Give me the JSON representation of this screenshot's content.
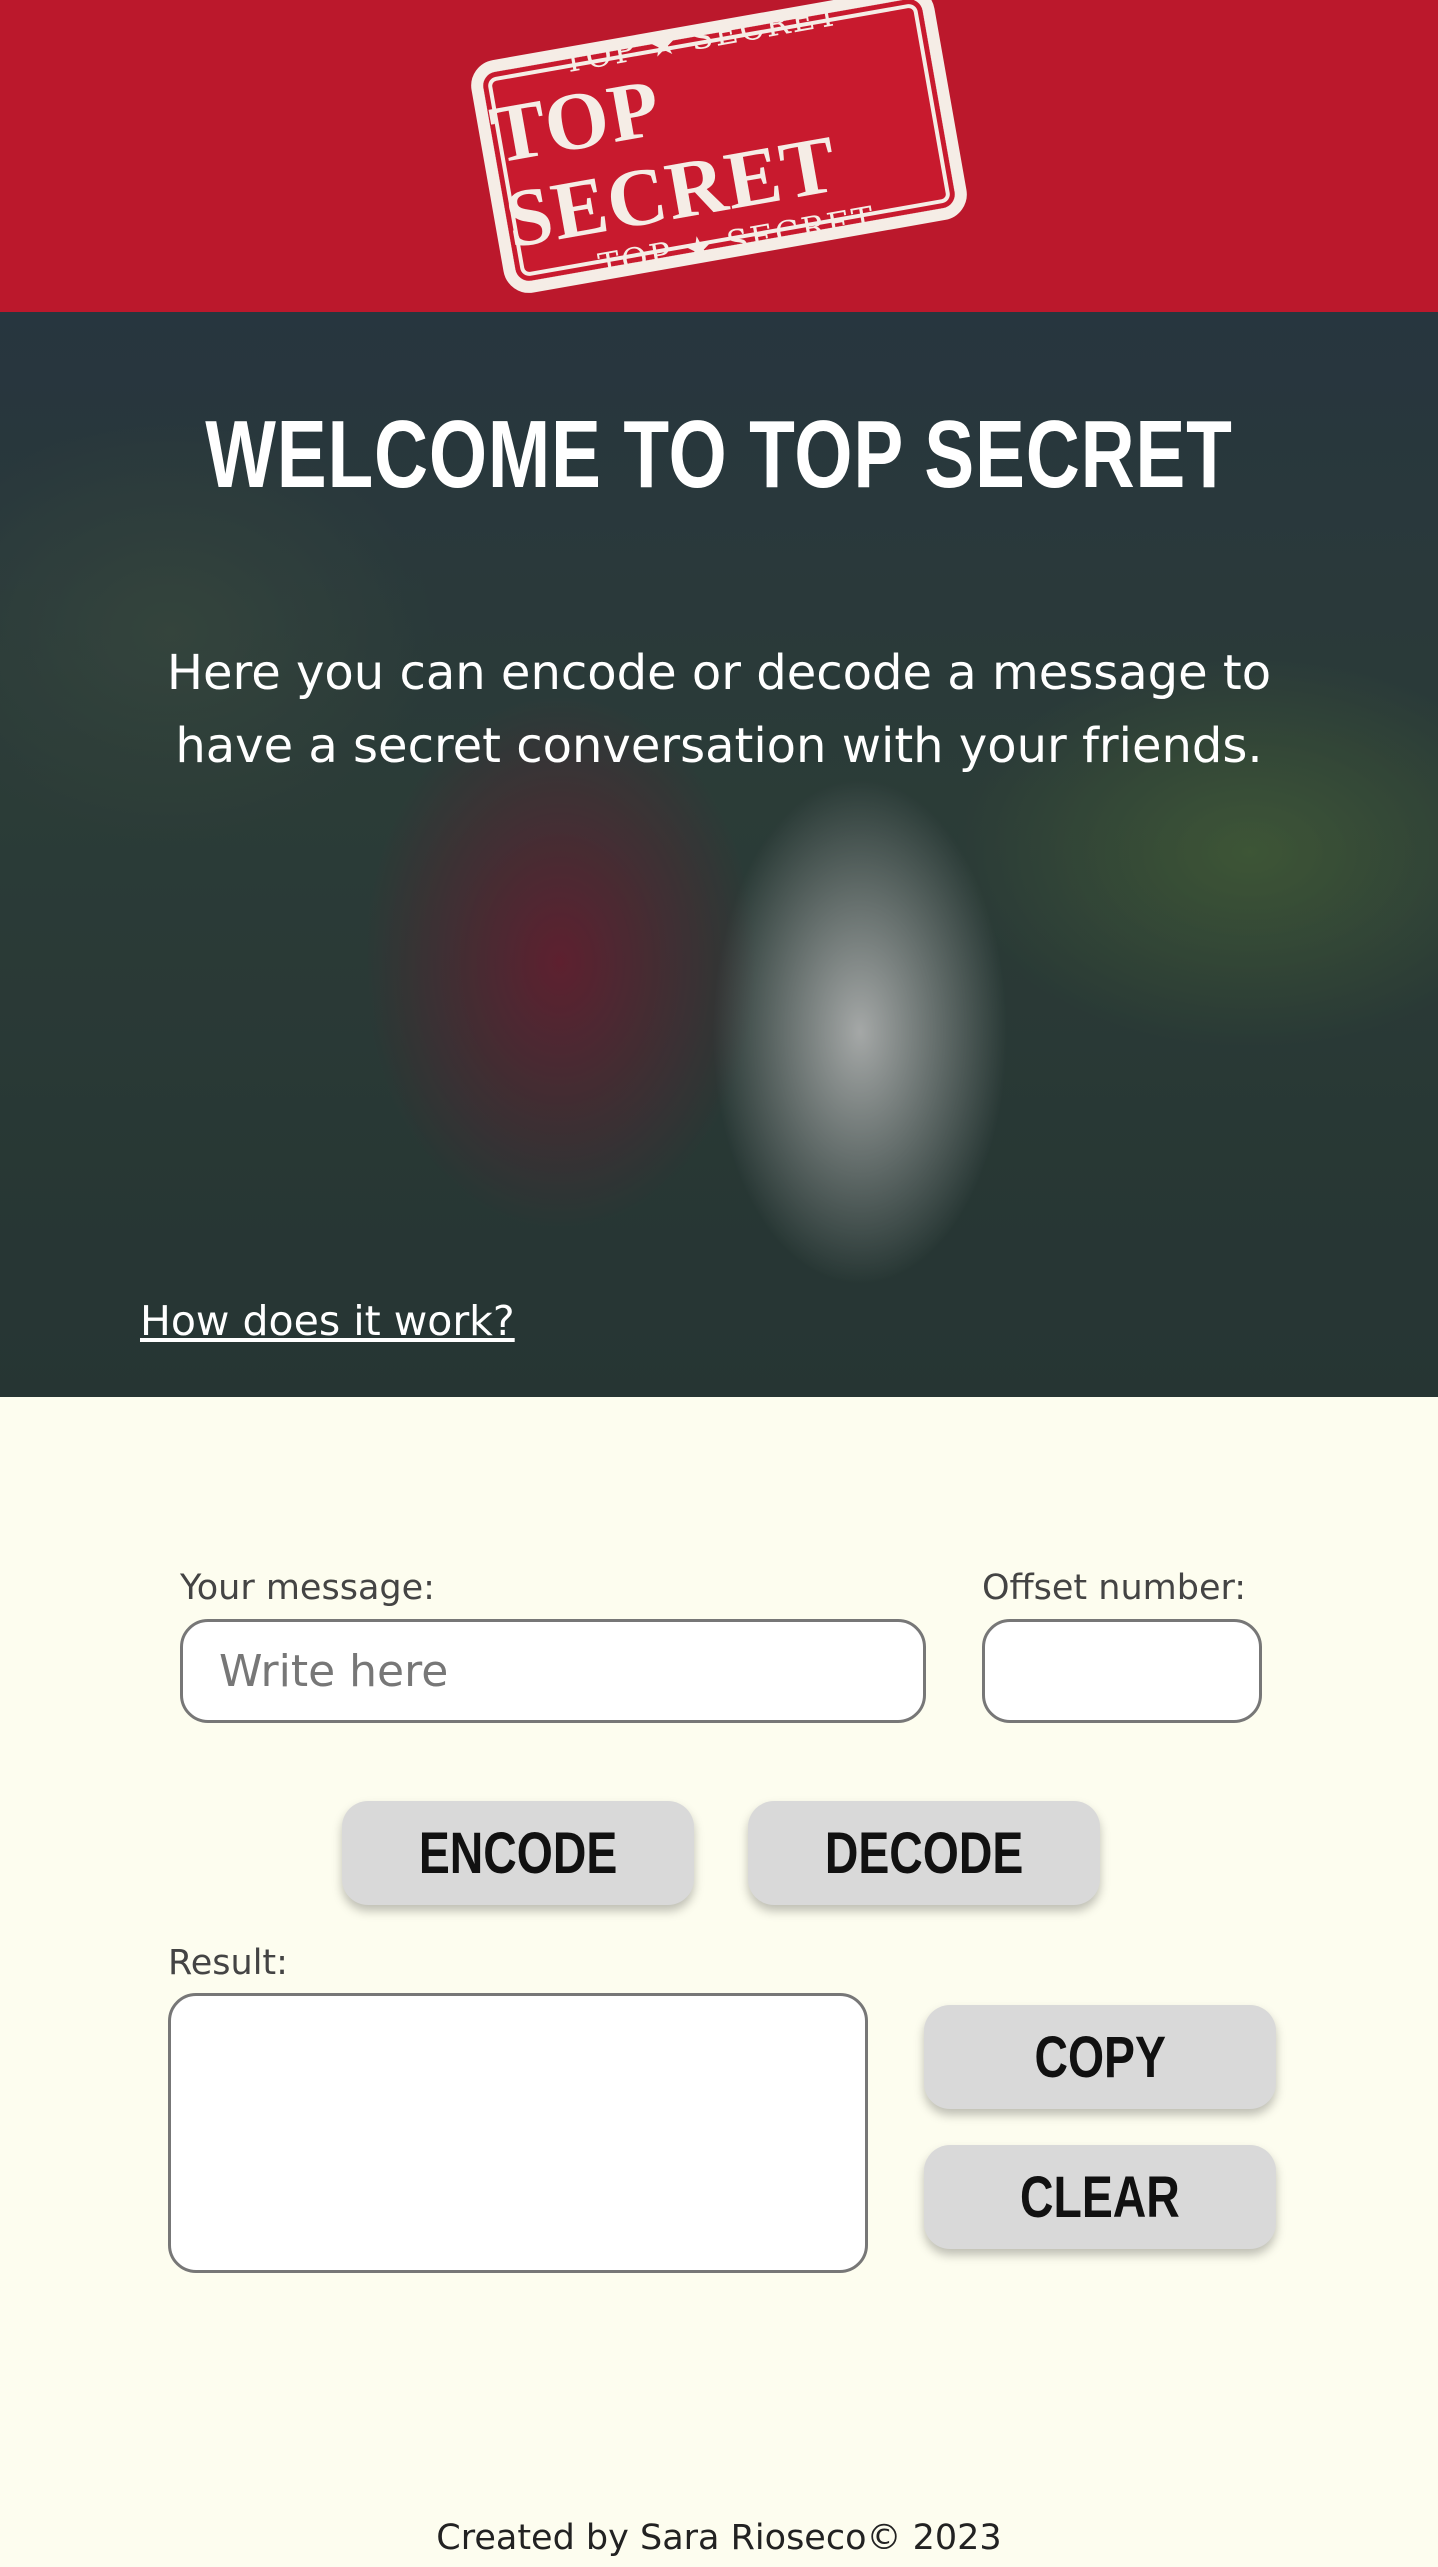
{
  "header": {
    "logo": {
      "top_line": "TOP ★ SECRET",
      "main": "TOP SECRET",
      "bottom_line": "TOP ★ SECRET"
    }
  },
  "hero": {
    "title": "WELCOME TO TOP SECRET",
    "description": "Here you can encode or decode a message to have a secret conversation with your friends.",
    "link": "How does it work?"
  },
  "form": {
    "message_label": "Your message:",
    "message_placeholder": "Write here",
    "message_value": "",
    "offset_label": "Offset number:",
    "offset_value": "",
    "encode_label": "ENCODE",
    "decode_label": "DECODE",
    "result_label": "Result:",
    "result_value": "",
    "copy_label": "COPY",
    "clear_label": "CLEAR"
  },
  "footer": {
    "text": "Created by Sara Rioseco© 2023"
  },
  "colors": {
    "header_bg": "#bb182c",
    "page_bg": "#fdfdef",
    "button_bg": "#d9d9d9"
  }
}
